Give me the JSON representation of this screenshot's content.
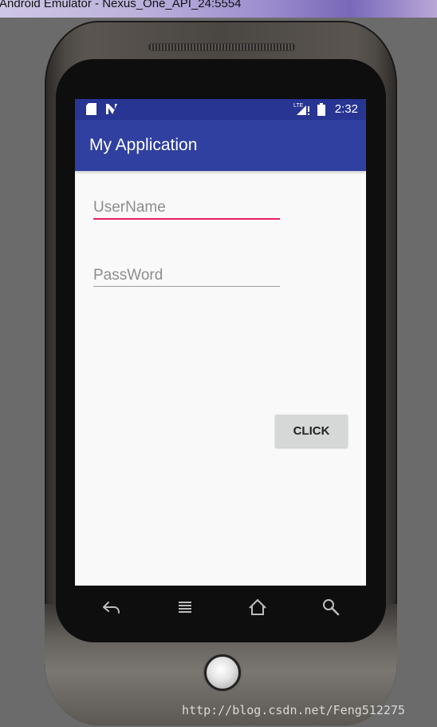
{
  "window": {
    "title": "Android Emulator - Nexus_One_API_24:5554"
  },
  "status_bar": {
    "icons": [
      "sd-card-icon",
      "nougat-n-icon",
      "lte-signal-icon",
      "battery-icon"
    ],
    "lte_label": "LTE",
    "time": "2:32"
  },
  "app_bar": {
    "title": "My Application"
  },
  "form": {
    "username_placeholder": "UserName",
    "password_placeholder": "PassWord",
    "button_label": "CLICK"
  },
  "nav": {
    "icons": [
      "back-icon",
      "menu-icon",
      "home-icon",
      "search-icon"
    ]
  },
  "watermark": {
    "text": "http://blog.csdn.net/Feng512275"
  },
  "colors": {
    "status_bar": "#283593",
    "app_bar": "#3040a0",
    "accent": "#e91e63",
    "button_bg": "#d6d7d7"
  }
}
